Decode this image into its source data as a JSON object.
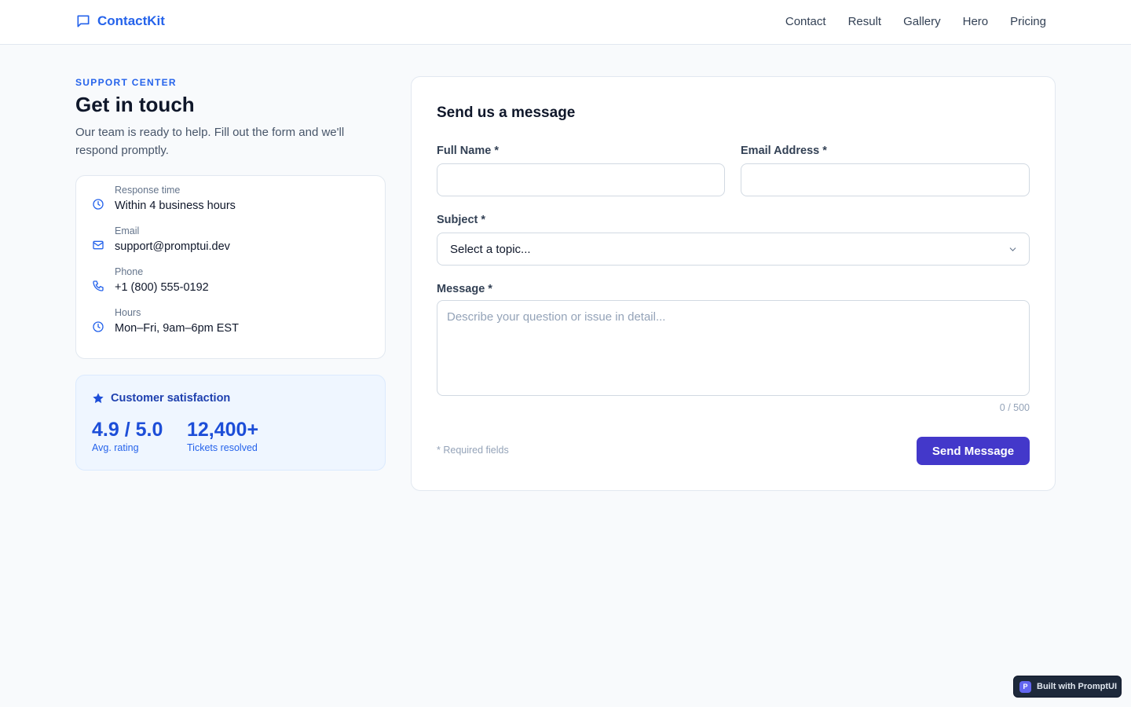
{
  "header": {
    "brand": "ContactKit",
    "nav": [
      "Contact",
      "Result",
      "Gallery",
      "Hero",
      "Pricing"
    ]
  },
  "intro": {
    "eyebrow": "SUPPORT CENTER",
    "title": "Get in touch",
    "description": "Our team is ready to help. Fill out the form and we'll respond promptly."
  },
  "contact_info": [
    {
      "icon": "clock-icon",
      "label": "Response time",
      "value": "Within 4 business hours"
    },
    {
      "icon": "mail-icon",
      "label": "Email",
      "value": "support@promptui.dev"
    },
    {
      "icon": "phone-icon",
      "label": "Phone",
      "value": "+1 (800) 555-0192"
    },
    {
      "icon": "clock-icon",
      "label": "Hours",
      "value": "Mon–Fri, 9am–6pm EST"
    }
  ],
  "satisfaction": {
    "title": "Customer satisfaction",
    "stats": [
      {
        "value": "4.9 / 5.0",
        "label": "Avg. rating"
      },
      {
        "value": "12,400+",
        "label": "Tickets resolved"
      }
    ]
  },
  "form": {
    "title": "Send us a message",
    "full_name_label": "Full Name *",
    "full_name_value": "",
    "email_label": "Email Address *",
    "email_value": "",
    "subject_label": "Subject *",
    "subject_selected": "Select a topic...",
    "message_label": "Message *",
    "message_placeholder": "Describe your question or issue in detail...",
    "char_counter": "0 / 500",
    "required_note": "* Required fields",
    "submit_label": "Send Message"
  },
  "badge": {
    "logo_letter": "P",
    "text": "Built with PromptUI"
  },
  "colors": {
    "accent": "#2563eb",
    "button": "#4338ca",
    "background": "#f8fafc"
  }
}
